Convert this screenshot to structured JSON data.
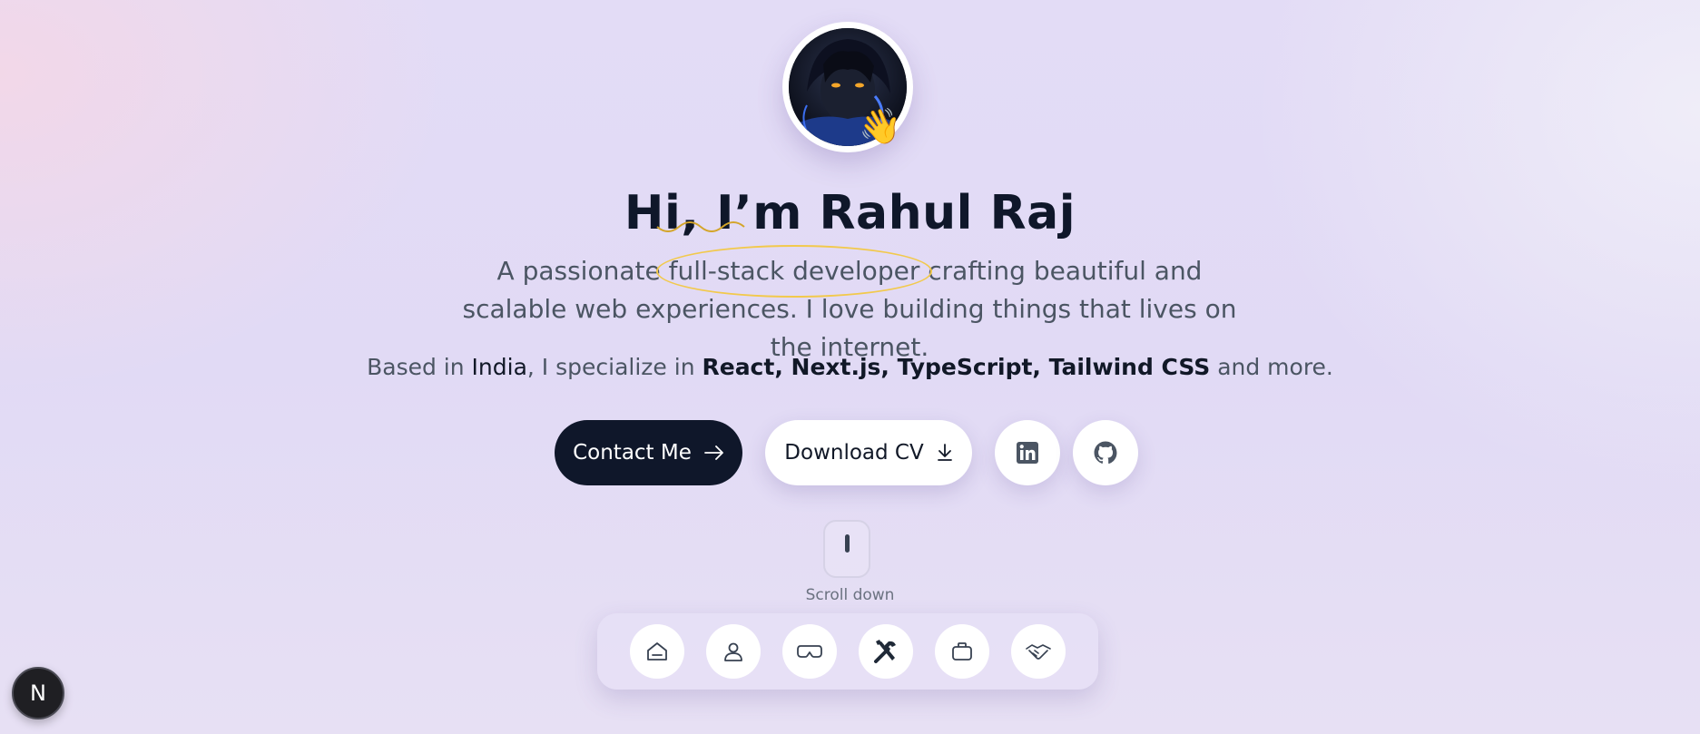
{
  "hero": {
    "wave_emoji": "👋",
    "title": "Hi, I’m Rahul Raj",
    "lead_before": "A passionate ",
    "lead_highlight": "full-stack developer",
    "lead_after": " crafting beautiful and scalable web experiences. I love building things that lives on the internet.",
    "sub_prefix": "Based in ",
    "sub_location": "India",
    "sub_middle": ", I specialize in ",
    "sub_skills": "React, Next.js, TypeScript, Tailwind CSS",
    "sub_suffix": " and more."
  },
  "actions": {
    "contact_label": "Contact Me",
    "download_label": "Download CV",
    "linkedin_icon": "linkedin-icon",
    "github_icon": "github-icon"
  },
  "scroll": {
    "label": "Scroll down"
  },
  "dock": {
    "items": [
      {
        "icon": "home-icon"
      },
      {
        "icon": "user-icon"
      },
      {
        "icon": "vr-headset-icon"
      },
      {
        "icon": "tools-icon"
      },
      {
        "icon": "briefcase-icon"
      },
      {
        "icon": "handshake-icon"
      }
    ]
  },
  "badge": {
    "letter": "N"
  },
  "colors": {
    "dark": "#0f172a",
    "highlight_ring": "#f2c94c",
    "muted_text": "#4b5563"
  }
}
